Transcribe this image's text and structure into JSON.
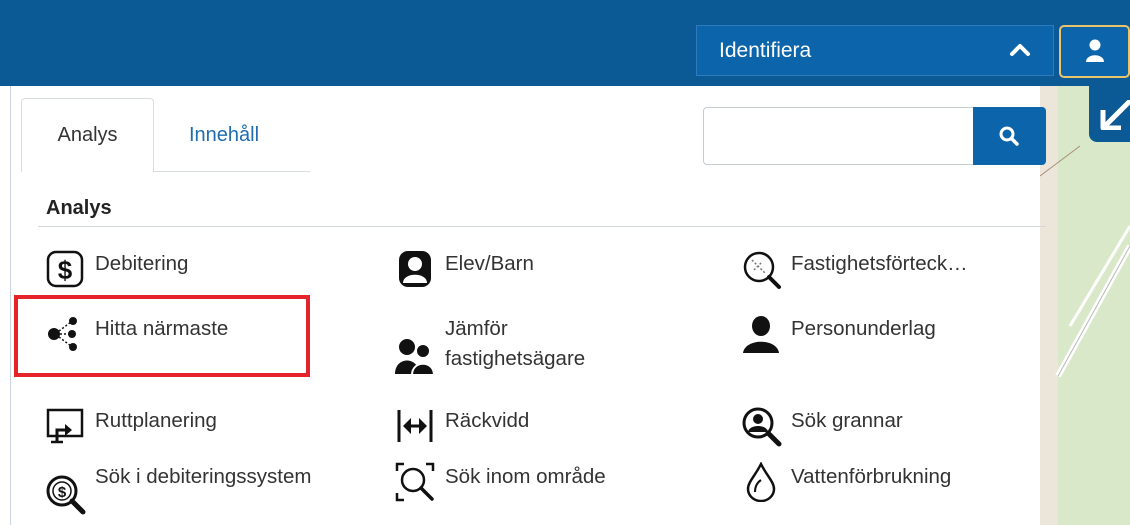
{
  "header": {
    "identify_label": "Identifiera",
    "identify_icon": "chevron-up-icon",
    "user_icon": "user-icon",
    "colors": {
      "bar": "#0b5a96",
      "button": "#0c65ab",
      "user_border": "#e9c46a"
    }
  },
  "map": {
    "collapse_icon": "arrow-collapse-icon"
  },
  "tabs": [
    {
      "label": "Analys",
      "active": true
    },
    {
      "label": "Innehåll",
      "active": false
    }
  ],
  "search": {
    "placeholder": "",
    "value": "",
    "button_icon": "search-icon"
  },
  "section": {
    "title": "Analys"
  },
  "tools": [
    {
      "label": "Debitering",
      "icon": "dollar-icon"
    },
    {
      "label": "Elev/Barn",
      "icon": "student-icon"
    },
    {
      "label": "Fastighetsförteck…",
      "icon": "property-search-icon"
    },
    {
      "label": "Hitta närmaste",
      "icon": "nearest-icon"
    },
    {
      "label": "Jämför fastighetsägare",
      "icon": "compare-owners-icon"
    },
    {
      "label": "Personunderlag",
      "icon": "person-icon"
    },
    {
      "label": "Ruttplanering",
      "icon": "route-icon"
    },
    {
      "label": "Räckvidd",
      "icon": "range-icon"
    },
    {
      "label": "Sök grannar",
      "icon": "neighbor-search-icon"
    },
    {
      "label": "Sök i debiteringssystem",
      "icon": "billing-search-icon"
    },
    {
      "label": "Sök inom område",
      "icon": "area-search-icon"
    },
    {
      "label": "Vattenförbrukning",
      "icon": "water-drop-icon"
    }
  ],
  "highlight_color": "#e5232b"
}
